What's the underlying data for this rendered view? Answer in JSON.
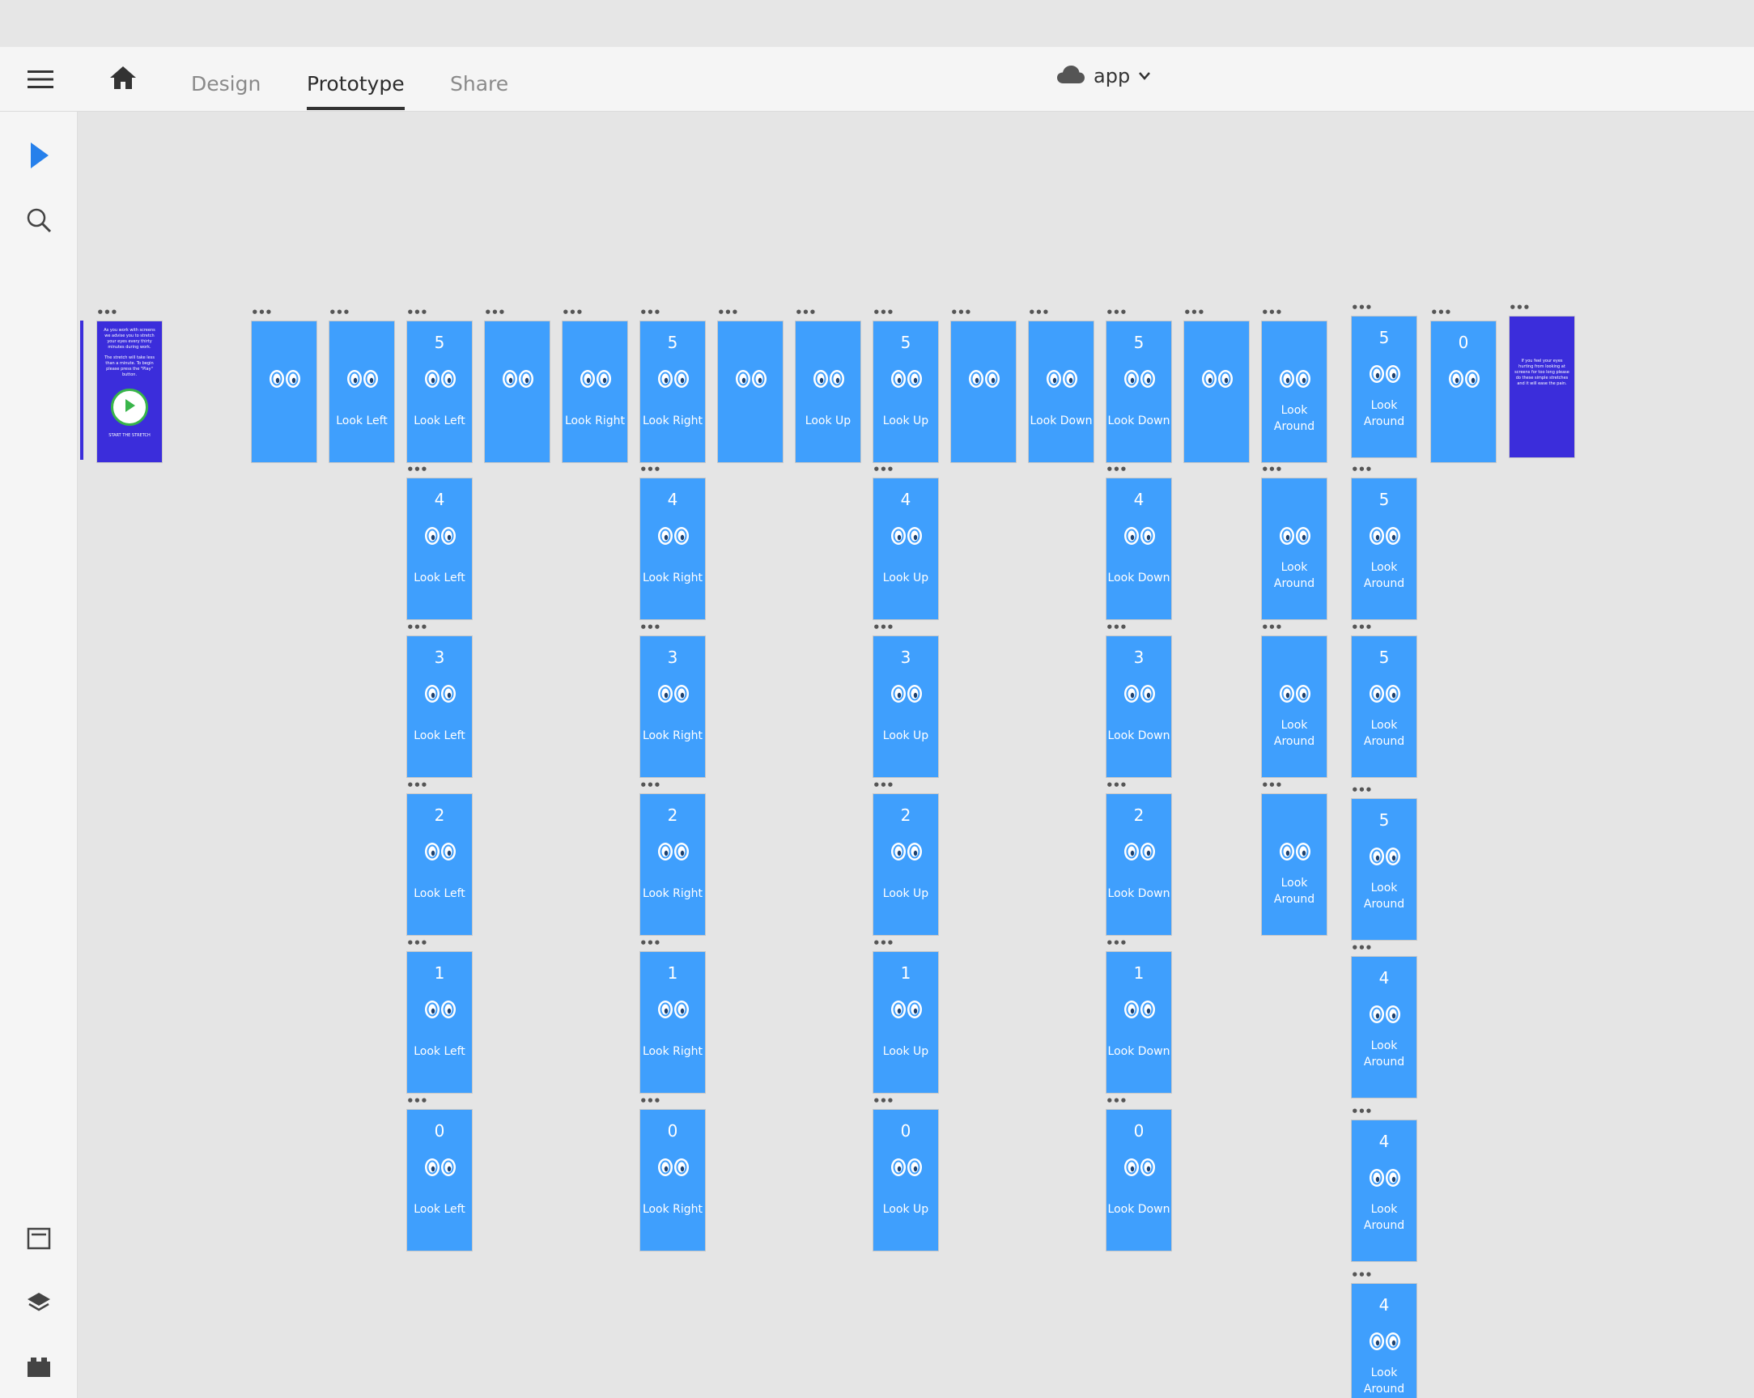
{
  "topnav": {
    "tabs": [
      {
        "label": "Design"
      },
      {
        "label": "Prototype"
      },
      {
        "label": "Share"
      }
    ],
    "doc_name": "app",
    "menu_icon": "hamburger-menu-icon",
    "home_icon": "home-icon",
    "cloud_icon": "cloud-icon",
    "chevron_icon": "chevron-down-icon"
  },
  "sidebar": {
    "tools": [
      {
        "name": "select-tool",
        "icon": "pointer-arrow-icon",
        "active": true
      },
      {
        "name": "zoom-tool",
        "icon": "search-icon",
        "active": false
      }
    ],
    "bottom_tools": [
      {
        "name": "assets-panel",
        "icon": "assets-icon"
      },
      {
        "name": "layers-panel",
        "icon": "layers-icon"
      },
      {
        "name": "plugins-panel",
        "icon": "plugins-icon"
      }
    ]
  },
  "colors": {
    "artboard_blue": "#3f9ffd",
    "artboard_purple": "#3b2ddb",
    "accent": "#2680eb",
    "play_green": "#39b54a"
  },
  "canvas": {
    "intro": {
      "text_1": "As you work with screens we advise you to stretch your eyes every thirty minutes during work.",
      "text_2": "The stretch will take less than a minute. To begin please press the \"Play\" button.",
      "cta": "START THE STRETCH"
    },
    "outro": {
      "text": "If you feel your eyes hurting from looking at screens for too long please do these simple stretches and it will ease the pain."
    },
    "artboards": [
      {
        "col": 0,
        "row": 0,
        "num": "",
        "label": ""
      },
      {
        "col": 1,
        "row": 0,
        "num": "",
        "label": "Look Left"
      },
      {
        "col": 2,
        "row": 0,
        "num": "5",
        "label": "Look Left"
      },
      {
        "col": 2,
        "row": 1,
        "num": "4",
        "label": "Look Left"
      },
      {
        "col": 2,
        "row": 2,
        "num": "3",
        "label": "Look Left"
      },
      {
        "col": 2,
        "row": 3,
        "num": "2",
        "label": "Look Left"
      },
      {
        "col": 2,
        "row": 4,
        "num": "1",
        "label": "Look Left"
      },
      {
        "col": 2,
        "row": 5,
        "num": "0",
        "label": "Look Left"
      },
      {
        "col": 3,
        "row": 0,
        "num": "",
        "label": ""
      },
      {
        "col": 4,
        "row": 0,
        "num": "",
        "label": "Look Right"
      },
      {
        "col": 5,
        "row": 0,
        "num": "5",
        "label": "Look Right"
      },
      {
        "col": 5,
        "row": 1,
        "num": "4",
        "label": "Look Right"
      },
      {
        "col": 5,
        "row": 2,
        "num": "3",
        "label": "Look Right"
      },
      {
        "col": 5,
        "row": 3,
        "num": "2",
        "label": "Look Right"
      },
      {
        "col": 5,
        "row": 4,
        "num": "1",
        "label": "Look Right"
      },
      {
        "col": 5,
        "row": 5,
        "num": "0",
        "label": "Look Right"
      },
      {
        "col": 6,
        "row": 0,
        "num": "",
        "label": ""
      },
      {
        "col": 7,
        "row": 0,
        "num": "",
        "label": "Look Up"
      },
      {
        "col": 8,
        "row": 0,
        "num": "5",
        "label": "Look Up"
      },
      {
        "col": 8,
        "row": 1,
        "num": "4",
        "label": "Look Up"
      },
      {
        "col": 8,
        "row": 2,
        "num": "3",
        "label": "Look Up"
      },
      {
        "col": 8,
        "row": 3,
        "num": "2",
        "label": "Look Up"
      },
      {
        "col": 8,
        "row": 4,
        "num": "1",
        "label": "Look Up"
      },
      {
        "col": 8,
        "row": 5,
        "num": "0",
        "label": "Look Up"
      },
      {
        "col": 9,
        "row": 0,
        "num": "",
        "label": ""
      },
      {
        "col": 10,
        "row": 0,
        "num": "",
        "label": "Look Down"
      },
      {
        "col": 11,
        "row": 0,
        "num": "5",
        "label": "Look Down"
      },
      {
        "col": 11,
        "row": 1,
        "num": "4",
        "label": "Look Down"
      },
      {
        "col": 11,
        "row": 2,
        "num": "3",
        "label": "Look Down"
      },
      {
        "col": 11,
        "row": 3,
        "num": "2",
        "label": "Look Down"
      },
      {
        "col": 11,
        "row": 4,
        "num": "1",
        "label": "Look Down"
      },
      {
        "col": 11,
        "row": 5,
        "num": "0",
        "label": "Look Down"
      },
      {
        "col": 12,
        "row": 0,
        "num": "",
        "label": ""
      },
      {
        "col": 13,
        "row": 0,
        "num": "",
        "label": "Look Around"
      },
      {
        "col": 13,
        "row": 1,
        "num": "",
        "label": "Look Around"
      },
      {
        "col": 13,
        "row": 2,
        "num": "",
        "label": "Look Around"
      },
      {
        "col": 13,
        "row": 3,
        "num": "",
        "label": "Look Around"
      },
      {
        "col": 14,
        "row": 0,
        "num": "5",
        "label": "Look Around"
      },
      {
        "col": 14,
        "row": 1,
        "num": "5",
        "label": "Look Around"
      },
      {
        "col": 14,
        "row": 2,
        "num": "5",
        "label": "Look Around"
      },
      {
        "col": 14,
        "row": 3,
        "num": "5",
        "label": "Look Around"
      },
      {
        "col": 14,
        "row": 4,
        "num": "4",
        "label": "Look Around"
      },
      {
        "col": 14,
        "row": 5,
        "num": "4",
        "label": "Look Around"
      },
      {
        "col": 14,
        "row": 6,
        "num": "4",
        "label": "Look Around"
      },
      {
        "col": 15,
        "row": 0,
        "num": "0",
        "label": ""
      }
    ]
  }
}
